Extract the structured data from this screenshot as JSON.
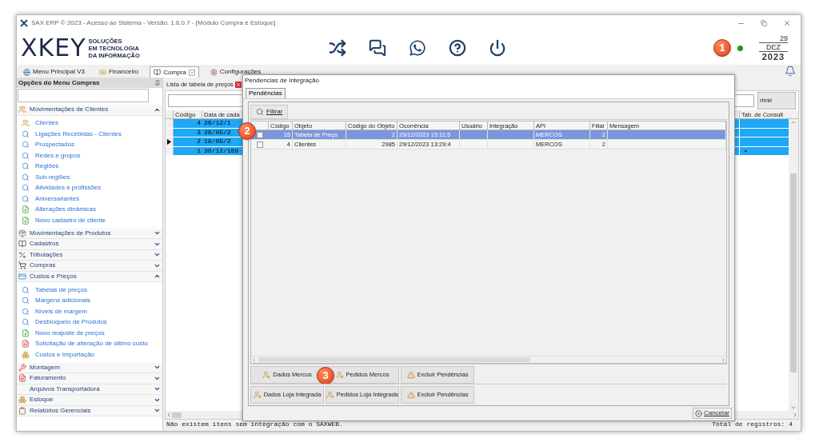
{
  "window": {
    "title": "SAX ERP © 2023 - Acesso ao Sistema - Versão: 1.6.0.7 - [Módulo Compra e Estoque]"
  },
  "header": {
    "logo": "XKEY",
    "tagline": [
      "SOLUÇÕES",
      "EM TECNOLOGIA",
      "DA INFORMAÇÃO"
    ],
    "callout": "1",
    "online": true,
    "date": {
      "day": "29",
      "month": "DEZ",
      "year": "2023"
    }
  },
  "tabs": [
    {
      "label": "Menu Principal V3",
      "kind": "globe",
      "selected": false,
      "closable": false
    },
    {
      "label": "Financeiro",
      "kind": "money",
      "selected": false,
      "closable": false
    },
    {
      "label": "Compra",
      "kind": "book",
      "selected": true,
      "closable": true
    },
    {
      "label": "Configurações",
      "kind": "gear",
      "selected": false,
      "closable": false
    }
  ],
  "sidebar": {
    "title": "Opções do Menu Compras",
    "sections": [
      {
        "label": "Movimentações de Clientes",
        "kind": "people",
        "expanded": true,
        "items": [
          {
            "label": "Clientes",
            "kind": "people"
          },
          {
            "label": "Ligações Recebidas - Clientes",
            "kind": "search"
          },
          {
            "label": "Prospectados",
            "kind": "search"
          },
          {
            "label": "Redes e grupos",
            "kind": "search"
          },
          {
            "label": "Regiões",
            "kind": "search"
          },
          {
            "label": "Sub-regiões",
            "kind": "search"
          },
          {
            "label": "Atividades e profissões",
            "kind": "search"
          },
          {
            "label": "Aniversariantes",
            "kind": "search"
          },
          {
            "label": "Alterações dinâmicas",
            "kind": "add"
          },
          {
            "label": "Novo cadastro de cliente",
            "kind": "add"
          }
        ]
      },
      {
        "label": "Movimentações de Produtos",
        "kind": "product",
        "expanded": false
      },
      {
        "label": "Cadastros",
        "kind": "book",
        "expanded": false
      },
      {
        "label": "Tributações",
        "kind": "percent",
        "expanded": false
      },
      {
        "label": "Compras",
        "kind": "cart",
        "expanded": false
      },
      {
        "label": "Custos e Preços",
        "kind": "cost",
        "expanded": true,
        "items": [
          {
            "label": "Tabelas de preços",
            "kind": "search"
          },
          {
            "label": "Margens adicionais",
            "kind": "search"
          },
          {
            "label": "Níveis de margem",
            "kind": "search"
          },
          {
            "label": "Desbloqueio de Produtos",
            "kind": "search"
          },
          {
            "label": "Novo reajuste de preços",
            "kind": "add"
          },
          {
            "label": "Solicitação de alteração de último custo",
            "kind": "doc"
          },
          {
            "label": "Custos e Importação",
            "kind": "boxes"
          }
        ]
      },
      {
        "label": "Montagem",
        "kind": "tools",
        "expanded": false
      },
      {
        "label": "Faturamento",
        "kind": "doc",
        "expanded": false
      },
      {
        "label": "Arquivos Transportadora",
        "kind": "plain",
        "expanded": false
      },
      {
        "label": "Estoque",
        "kind": "boxes",
        "expanded": false
      },
      {
        "label": "Relatórios Gerenciais",
        "kind": "clipboard",
        "expanded": false
      }
    ]
  },
  "price_list": {
    "title": "Lista de tabela de preços",
    "button": "rimir",
    "columns": [
      "Código",
      "Data de cada",
      "Tab. de Consult"
    ],
    "callout": "2",
    "rows": [
      {
        "code": "4",
        "date": "26/12/1",
        "selected": true,
        "current": false
      },
      {
        "code": "3",
        "date": "26/05/2",
        "selected": true,
        "current": false
      },
      {
        "code": "2",
        "date": "18/05/2",
        "selected": true,
        "current": true
      },
      {
        "code": "1",
        "date": "30/12/189",
        "selected": true,
        "current": false,
        "tab_consult": "•"
      }
    ],
    "status": "Não existem itens sem integração com o SAXWEB.",
    "total": "Total de registros: 4"
  },
  "dialog": {
    "title": "Pendencias de Integração",
    "tabs": [
      {
        "label": "Pendências",
        "selected": true
      }
    ],
    "filter_button": "Filtrar",
    "callout": "3",
    "columns": [
      "Código",
      "Objeto",
      "Código do Objeto",
      "Ocorrência",
      "Usuário",
      "Integração",
      "API",
      "Filial",
      "Mensagem"
    ],
    "rows": [
      {
        "selected": true,
        "checked": false,
        "cells": [
          "15",
          "Tabela de Preço",
          "2",
          "29/12/2023 15:11:5",
          null,
          null,
          "MERCOS",
          "2",
          null
        ]
      },
      {
        "selected": false,
        "checked": false,
        "cells": [
          "4",
          "Clientes",
          "2985",
          "29/12/2023 13:29:4",
          null,
          null,
          "MERCOS",
          "2",
          null
        ]
      }
    ],
    "action_rows": [
      {
        "buttons": [
          {
            "label": "Dados Mercos",
            "kind": "person"
          },
          {
            "label": "Pedidos Mercos",
            "kind": "person"
          },
          {
            "label": "Excluir Pendências",
            "kind": "warning"
          }
        ]
      },
      {
        "buttons": [
          {
            "label": "Dados Loja Integrada",
            "kind": "person"
          },
          {
            "label": "Pedidos Loja Integrada",
            "kind": "person"
          },
          {
            "label": "Excluir Pendências",
            "kind": "warning"
          }
        ]
      }
    ],
    "cancel_button": "Cancelar"
  }
}
